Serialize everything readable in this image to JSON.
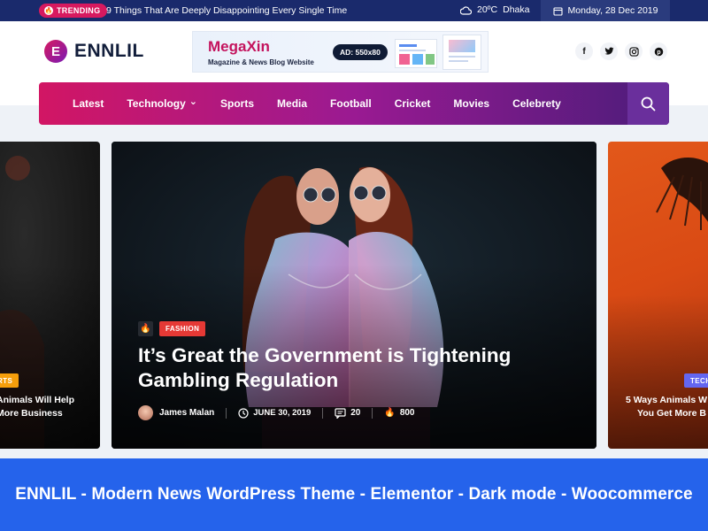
{
  "topbar": {
    "trending_label": "TRENDING",
    "trending_text": "9 Things That Are Deeply Disappointing Every Single Time",
    "weather_temp": "20ºC",
    "weather_city": "Dhaka",
    "date": "Monday, 28 Dec 2019"
  },
  "header": {
    "logo_mark": "E",
    "logo_text": "ENNLIL",
    "ad": {
      "title": "MegaXin",
      "subtitle": "Magazine & News Blog Website",
      "size_label": "AD: 550x80"
    },
    "socials": [
      {
        "name": "facebook",
        "glyph": "f"
      },
      {
        "name": "twitter",
        "glyph": "t"
      },
      {
        "name": "instagram",
        "glyph": "◎"
      },
      {
        "name": "pinterest",
        "glyph": "p"
      }
    ]
  },
  "nav": {
    "items": [
      "Latest",
      "Technology",
      "Sports",
      "Media",
      "Football",
      "Cricket",
      "Movies",
      "Celebrety"
    ],
    "dropdown_item": "Technology"
  },
  "slider": {
    "left": {
      "category": "RTS",
      "title_line1": "Animals Will Help",
      "title_line2": "More Business"
    },
    "main": {
      "category": "FASHION",
      "title": "It’s Great the Government is Tightening Gambling Regulation",
      "author": "James Malan",
      "date": "JUNE 30, 2019",
      "comments": "20",
      "views": "800"
    },
    "right": {
      "category": "TECH",
      "title_line1": "5 Ways Animals W",
      "title_line2": "You Get More B"
    }
  },
  "banner": {
    "text": "ENNLIL - Modern News WordPress Theme - Elementor - Dark mode - Woocommerce"
  },
  "colors": {
    "topbar": "#1a2a6c",
    "accent_pink": "#d7195f",
    "accent_purple": "#4b1c7a",
    "banner": "#2563eb",
    "fashion_tag": "#e53935",
    "sports_tag": "#f59e0b",
    "tech_tag": "#6366f1"
  }
}
